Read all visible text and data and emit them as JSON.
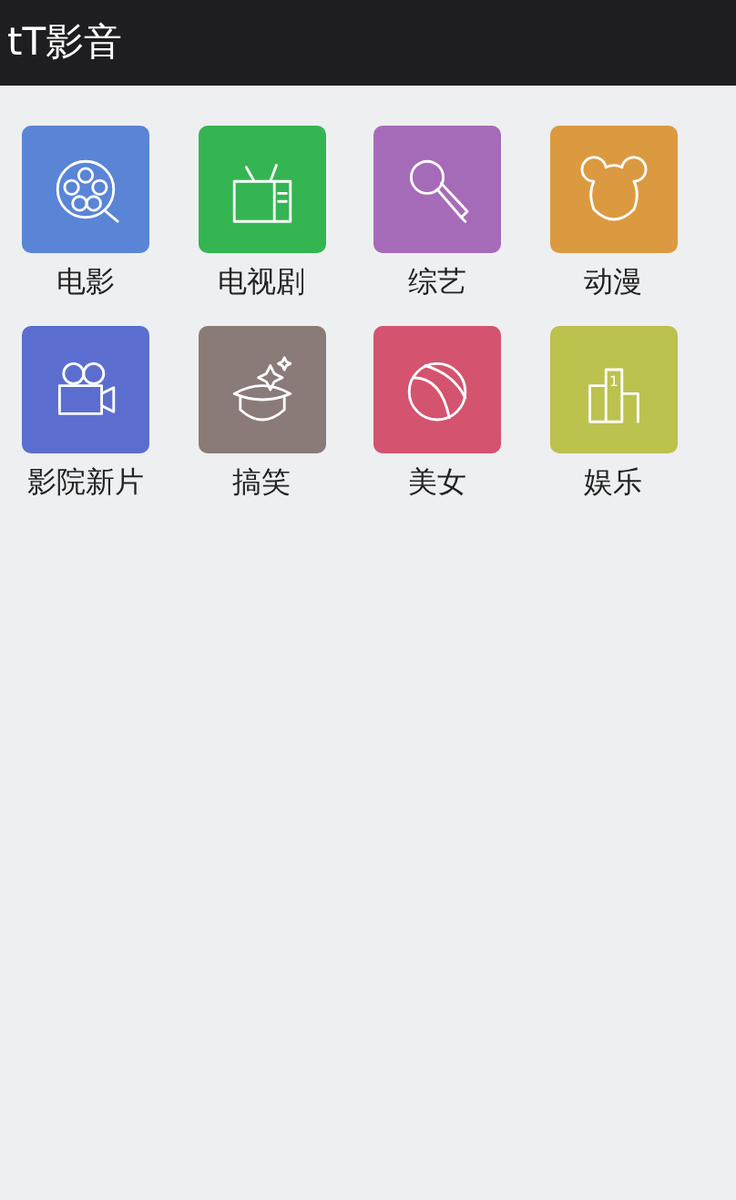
{
  "app_bar": {
    "title": "tT影音"
  },
  "categories": [
    {
      "label": "电影",
      "color": "#5a84d6"
    },
    {
      "label": "电视剧",
      "color": "#34b552"
    },
    {
      "label": "综艺",
      "color": "#a66bb8"
    },
    {
      "label": "动漫",
      "color": "#dc9a40"
    },
    {
      "label": "影院新片",
      "color": "#5b6ed0"
    },
    {
      "label": "搞笑",
      "color": "#8a7a78"
    },
    {
      "label": "美女",
      "color": "#d4536f"
    },
    {
      "label": "娱乐",
      "color": "#bcc24e",
      "icon_text": "1"
    }
  ]
}
